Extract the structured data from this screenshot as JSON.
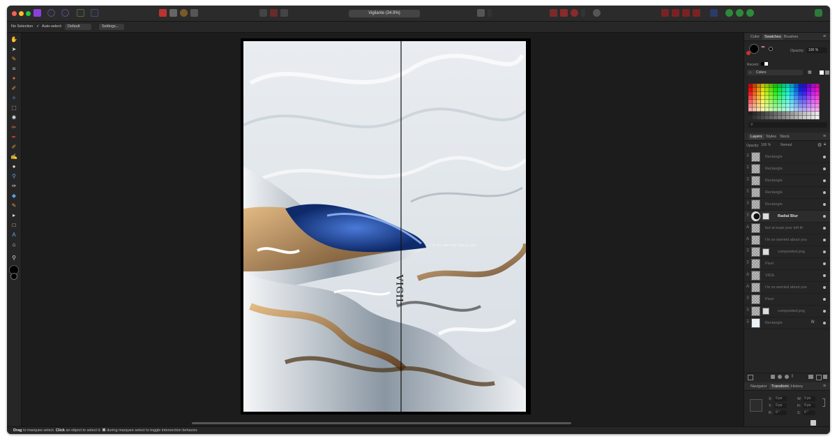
{
  "titlebar": {
    "document_title": "Vigilante (34.9%)"
  },
  "context_toolbar": {
    "selection_label": "No Selection",
    "autoselect_label": "Auto-select:",
    "autoselect_value": "Default",
    "settings_label": "Settings..."
  },
  "artwork": {
    "vertical_text": "VIGIL",
    "overlay_text": "I'm so worried about you"
  },
  "color_panel": {
    "tabs": [
      "Color",
      "Swatches",
      "Brushes"
    ],
    "active_tab": "Swatches",
    "opacity_label": "Opacity:",
    "opacity_value": "100 %",
    "recent_label": "Recent:",
    "palette_name": "Colors"
  },
  "layers_panel": {
    "tabs": [
      "Layers",
      "Styles",
      "Stock"
    ],
    "opacity_label": "Opacity:",
    "opacity_value": "100 %",
    "blend_mode": "Normal",
    "layers": [
      {
        "name": "Rectangle",
        "kind": "rect"
      },
      {
        "name": "Rectangle",
        "kind": "rect"
      },
      {
        "name": "Rectangle",
        "kind": "rect"
      },
      {
        "name": "Rectangle",
        "kind": "rect"
      },
      {
        "name": "Rectangle",
        "kind": "rect"
      },
      {
        "name": "Radial Blur",
        "kind": "filter"
      },
      {
        "name": "but at least your left th",
        "kind": "text"
      },
      {
        "name": "I'm so worried about you",
        "kind": "text"
      },
      {
        "name": "composited.png",
        "kind": "image"
      },
      {
        "name": "Pixel",
        "kind": "pixel"
      },
      {
        "name": "VIGIL",
        "kind": "text"
      },
      {
        "name": "I'm so worried about you",
        "kind": "text"
      },
      {
        "name": "Pixel",
        "kind": "pixel"
      },
      {
        "name": "composited.png",
        "kind": "image"
      },
      {
        "name": "Rectangle",
        "kind": "rect-fx"
      }
    ]
  },
  "transform_panel": {
    "tabs": [
      "Navigator",
      "Transform",
      "History"
    ],
    "fields": [
      {
        "label": "X:",
        "value": "0 px"
      },
      {
        "label": "W:",
        "value": "0 px"
      },
      {
        "label": "Y:",
        "value": "0 px"
      },
      {
        "label": "H:",
        "value": "0 px"
      },
      {
        "label": "R:",
        "value": "0 °"
      },
      {
        "label": "S:",
        "value": "0 °"
      }
    ]
  },
  "status_bar": {
    "w1": "Drag",
    "t1": " to marquee select. ",
    "w2": "Click",
    "t2": " an object to select it. ",
    "w3": "⌘",
    "t3": " during marquee select to toggle intersection behavior."
  },
  "colors": {
    "accent_purple": "#8b3fdc",
    "window_bg": "#1f1f1f",
    "panel_bg": "#252525"
  }
}
